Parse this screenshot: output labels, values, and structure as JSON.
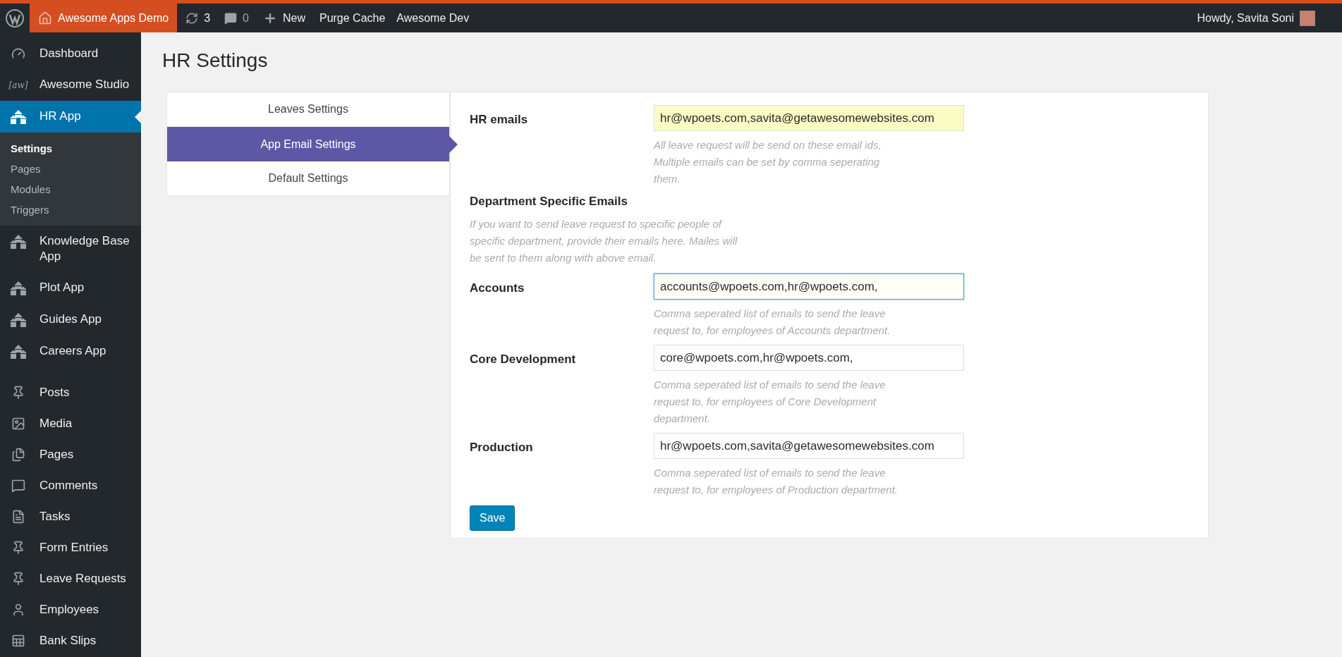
{
  "admin_bar": {
    "site": "Awesome Apps Demo",
    "updates": "3",
    "comments": "0",
    "new": "New",
    "links": [
      "Purge Cache",
      "Awesome Dev"
    ],
    "greeting": "Howdy, Savita Soni"
  },
  "sidebar": {
    "sections": [
      {
        "items": [
          {
            "label": "Dashboard",
            "kind": "gauge",
            "selected": false
          },
          {
            "label": "Awesome Studio",
            "kind": "text",
            "icon_text": "[aw]",
            "selected": false
          },
          {
            "label": "HR App",
            "kind": "houses",
            "selected": true,
            "children": [
              {
                "label": "Settings",
                "selected": true
              },
              {
                "label": "Pages",
                "selected": false
              },
              {
                "label": "Modules",
                "selected": false
              },
              {
                "label": "Triggers",
                "selected": false
              }
            ]
          },
          {
            "label": "Knowledge Base App",
            "kind": "houses",
            "selected": false
          },
          {
            "label": "Plot App",
            "kind": "houses",
            "selected": false
          },
          {
            "label": "Guides App",
            "kind": "houses",
            "selected": false
          },
          {
            "label": "Careers App",
            "kind": "houses",
            "selected": false
          }
        ]
      },
      {
        "items": [
          {
            "label": "Posts",
            "kind": "pin",
            "selected": false
          },
          {
            "label": "Media",
            "kind": "media",
            "selected": false
          },
          {
            "label": "Pages",
            "kind": "pages",
            "selected": false
          },
          {
            "label": "Comments",
            "kind": "comment",
            "selected": false
          },
          {
            "label": "Tasks",
            "kind": "task",
            "selected": false
          },
          {
            "label": "Form Entries",
            "kind": "pin",
            "selected": false
          },
          {
            "label": "Leave Requests",
            "kind": "pin",
            "selected": false
          },
          {
            "label": "Employees",
            "kind": "person",
            "selected": false
          },
          {
            "label": "Bank Slips",
            "kind": "sheet",
            "selected": false
          }
        ]
      }
    ]
  },
  "page": {
    "title": "HR Settings",
    "tabs": [
      {
        "label": "Leaves Settings",
        "selected": false
      },
      {
        "label": "App Email Settings",
        "selected": true
      },
      {
        "label": "Default Settings",
        "selected": false
      }
    ],
    "form": [
      {
        "kind": "field",
        "label": "HR emails",
        "value": "hr@wpoets.com,savita@getawesomewebsites.com",
        "autofilled": true,
        "focused": false,
        "hint": "All leave request will be send on these email ids, Multiple emails can be set by comma seperating them."
      },
      {
        "kind": "heading",
        "label": "Department Specific Emails",
        "hint": "If you want to send leave request to specific people of specific department, provide their emails here. Mailes will be sent to them along with above email."
      },
      {
        "kind": "field",
        "label": "Accounts",
        "value": "accounts@wpoets.com,hr@wpoets.com,",
        "autofilled": false,
        "focused": true,
        "hint": "Comma seperated list of emails to send the leave request to, for employees of Accounts department."
      },
      {
        "kind": "field",
        "label": "Core Development",
        "value": "core@wpoets.com,hr@wpoets.com,",
        "autofilled": false,
        "focused": false,
        "hint": "Comma seperated list of emails to send the leave request to, for employees of Core Development department."
      },
      {
        "kind": "field",
        "label": "Production",
        "value": "hr@wpoets.com,savita@getawesomewebsites.com",
        "autofilled": false,
        "focused": false,
        "hint": "Comma seperated list of emails to send the leave request to, for employees of Production department."
      }
    ],
    "save": "Save"
  }
}
